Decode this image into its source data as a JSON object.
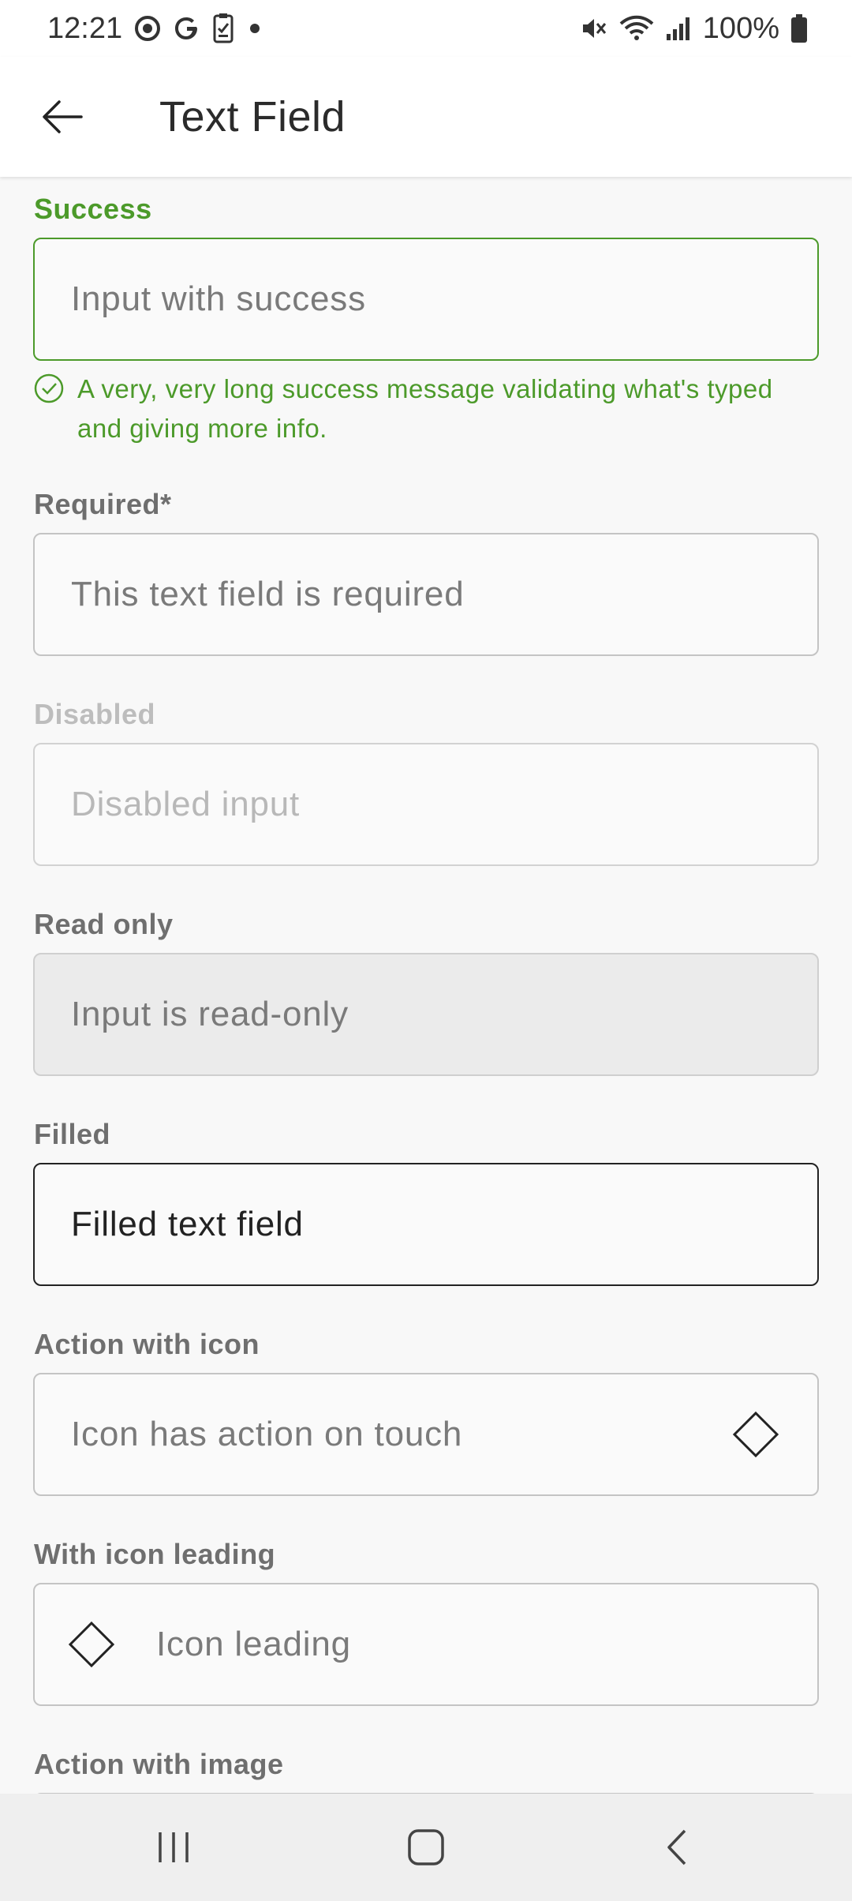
{
  "status_bar": {
    "time": "12:21",
    "battery": "100%",
    "icons": [
      "target-icon",
      "google-icon",
      "clipboard-icon",
      "dot-icon",
      "mute-icon",
      "wifi-icon",
      "signal-icon",
      "battery-icon"
    ]
  },
  "app_bar": {
    "title": "Text Field",
    "back_icon": "arrow-back-icon"
  },
  "fields": {
    "success": {
      "label": "Success",
      "placeholder": "Input with success",
      "helper": "A very, very long success message validating what's typed and giving more info.",
      "color": "#4c9a2a"
    },
    "required": {
      "label": "Required*",
      "placeholder": "This text field is required"
    },
    "disabled": {
      "label": "Disabled",
      "placeholder": "Disabled input"
    },
    "read_only": {
      "label": "Read only",
      "value": "Input is read-only"
    },
    "filled": {
      "label": "Filled",
      "value": "Filled text field"
    },
    "action_icon": {
      "label": "Action with icon",
      "placeholder": "Icon has action on touch",
      "icon": "diamond-icon"
    },
    "leading_icon": {
      "label": "With icon leading",
      "placeholder": "Icon leading",
      "icon": "diamond-icon"
    },
    "action_image": {
      "label": "Action with image"
    }
  },
  "nav_bar": {
    "buttons": [
      "recent-apps-icon",
      "home-icon",
      "back-icon"
    ]
  }
}
